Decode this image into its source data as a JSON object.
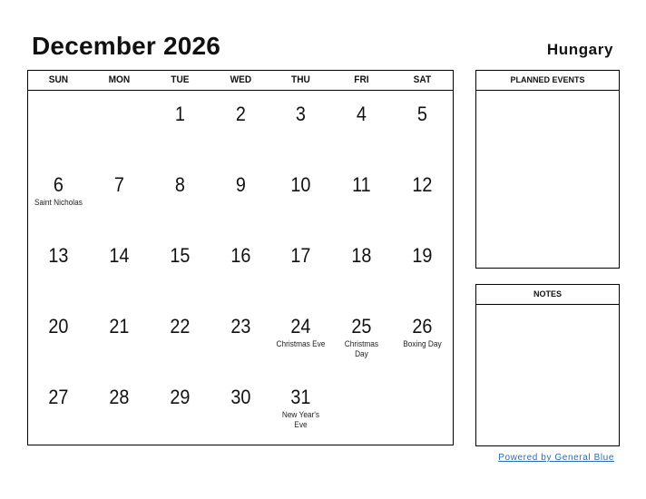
{
  "header": {
    "title": "December 2026",
    "country": "Hungary"
  },
  "calendar": {
    "weekdays": [
      "SUN",
      "MON",
      "TUE",
      "WED",
      "THU",
      "FRI",
      "SAT"
    ],
    "cells": [
      {
        "day": "",
        "holiday": ""
      },
      {
        "day": "",
        "holiday": ""
      },
      {
        "day": "1",
        "holiday": ""
      },
      {
        "day": "2",
        "holiday": ""
      },
      {
        "day": "3",
        "holiday": ""
      },
      {
        "day": "4",
        "holiday": ""
      },
      {
        "day": "5",
        "holiday": ""
      },
      {
        "day": "6",
        "holiday": "Saint Nicholas"
      },
      {
        "day": "7",
        "holiday": ""
      },
      {
        "day": "8",
        "holiday": ""
      },
      {
        "day": "9",
        "holiday": ""
      },
      {
        "day": "10",
        "holiday": ""
      },
      {
        "day": "11",
        "holiday": ""
      },
      {
        "day": "12",
        "holiday": ""
      },
      {
        "day": "13",
        "holiday": ""
      },
      {
        "day": "14",
        "holiday": ""
      },
      {
        "day": "15",
        "holiday": ""
      },
      {
        "day": "16",
        "holiday": ""
      },
      {
        "day": "17",
        "holiday": ""
      },
      {
        "day": "18",
        "holiday": ""
      },
      {
        "day": "19",
        "holiday": ""
      },
      {
        "day": "20",
        "holiday": ""
      },
      {
        "day": "21",
        "holiday": ""
      },
      {
        "day": "22",
        "holiday": ""
      },
      {
        "day": "23",
        "holiday": ""
      },
      {
        "day": "24",
        "holiday": "Christmas Eve"
      },
      {
        "day": "25",
        "holiday": "Christmas Day"
      },
      {
        "day": "26",
        "holiday": "Boxing Day"
      },
      {
        "day": "27",
        "holiday": ""
      },
      {
        "day": "28",
        "holiday": ""
      },
      {
        "day": "29",
        "holiday": ""
      },
      {
        "day": "30",
        "holiday": ""
      },
      {
        "day": "31",
        "holiday": "New Year's Eve"
      },
      {
        "day": "",
        "holiday": ""
      },
      {
        "day": "",
        "holiday": ""
      }
    ]
  },
  "panels": {
    "planned_events": "PLANNED EVENTS",
    "notes": "NOTES"
  },
  "footer": {
    "powered_by": "Powered by General Blue",
    "link_color": "#2a6db5"
  }
}
